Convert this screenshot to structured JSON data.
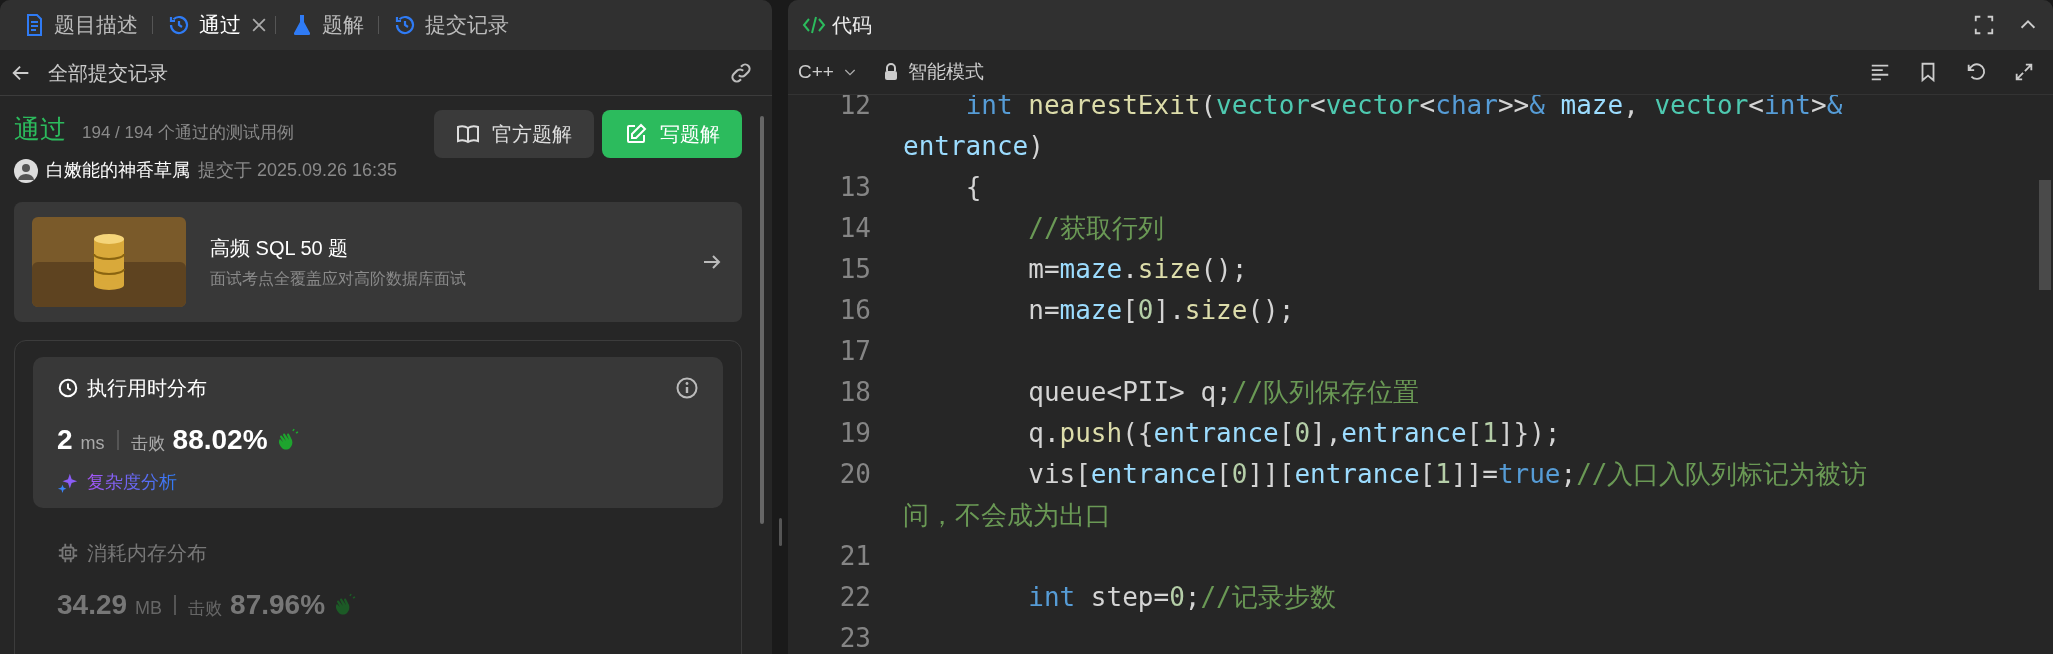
{
  "left_panel": {
    "tabs": [
      {
        "label": "题目描述",
        "selected": false,
        "closable": false
      },
      {
        "label": "通过",
        "selected": true,
        "closable": true
      },
      {
        "label": "题解",
        "selected": false,
        "closable": false
      },
      {
        "label": "提交记录",
        "selected": false,
        "closable": false
      }
    ],
    "header": {
      "title": "全部提交记录"
    },
    "submission": {
      "status": "通过",
      "cases": "194 / 194 个通过的测试用例",
      "author": "白嫩能的神香草属",
      "submitted": "提交于 2025.09.26 16:35"
    },
    "buttons": [
      {
        "label": "官方题解",
        "kind": "secondary"
      },
      {
        "label": "写题解",
        "kind": "primary"
      }
    ],
    "promo": {
      "title": "高频 SQL 50 题",
      "subtitle": "面试考点全覆盖应对高阶数据库面试"
    },
    "metrics": [
      {
        "title": "执行用时分布",
        "value": "2",
        "unit": "ms",
        "beat_label": "击败",
        "beat": "88.02%",
        "selected": true,
        "info": true,
        "analysis": "复杂度分析"
      },
      {
        "title": "消耗内存分布",
        "value": "34.29",
        "unit": "MB",
        "beat_label": "击败",
        "beat": "87.96%",
        "selected": false,
        "info": false
      }
    ]
  },
  "code_panel": {
    "title": "代码",
    "language": "C++",
    "mode": "智能模式",
    "lines": [
      {
        "number": "12",
        "tokens": [
          {
            "t": "    int",
            "kind": "kw"
          },
          {
            "t": " nearestExit",
            "kind": "fn"
          },
          {
            "t": "(",
            "kind": "plain"
          },
          {
            "t": "vector",
            "kind": "type"
          },
          {
            "t": "<",
            "kind": "plain"
          },
          {
            "t": "vector",
            "kind": "type"
          },
          {
            "t": "<",
            "kind": "plain"
          },
          {
            "t": "char",
            "kind": "kw"
          },
          {
            "t": ">>",
            "kind": "plain"
          },
          {
            "t": "&",
            "kind": "kw"
          },
          {
            "t": " maze",
            "kind": "var"
          },
          {
            "t": ", ",
            "kind": "plain"
          },
          {
            "t": "vector",
            "kind": "type"
          },
          {
            "t": "<",
            "kind": "plain"
          },
          {
            "t": "int",
            "kind": "kw"
          },
          {
            "t": ">",
            "kind": "plain"
          },
          {
            "t": "&",
            "kind": "kw"
          },
          {
            "t": " entrance",
            "kind": "var"
          },
          {
            "t": ")",
            "kind": "plain"
          }
        ]
      },
      {
        "number": "13",
        "tokens": [
          {
            "t": "    {",
            "kind": "plain"
          }
        ]
      },
      {
        "number": "14",
        "tokens": [
          {
            "t": "        //获取行列",
            "kind": "cmt"
          }
        ]
      },
      {
        "number": "15",
        "tokens": [
          {
            "t": "        m=",
            "kind": "plain"
          },
          {
            "t": "maze",
            "kind": "var"
          },
          {
            "t": ".",
            "kind": "plain"
          },
          {
            "t": "size",
            "kind": "fn"
          },
          {
            "t": "();",
            "kind": "plain"
          }
        ]
      },
      {
        "number": "16",
        "tokens": [
          {
            "t": "        n=",
            "kind": "plain"
          },
          {
            "t": "maze",
            "kind": "var"
          },
          {
            "t": "[",
            "kind": "plain"
          },
          {
            "t": "0",
            "kind": "num"
          },
          {
            "t": "].",
            "kind": "plain"
          },
          {
            "t": "size",
            "kind": "fn"
          },
          {
            "t": "();",
            "kind": "plain"
          }
        ]
      },
      {
        "number": "17"
      },
      {
        "number": "18",
        "tokens": [
          {
            "t": "        queue<PII> q;",
            "kind": "plain"
          },
          {
            "t": "//队列保存位置",
            "kind": "cmt"
          }
        ]
      },
      {
        "number": "19",
        "tokens": [
          {
            "t": "        q.",
            "kind": "plain"
          },
          {
            "t": "push",
            "kind": "fn"
          },
          {
            "t": "({",
            "kind": "plain"
          },
          {
            "t": "entrance",
            "kind": "var"
          },
          {
            "t": "[",
            "kind": "plain"
          },
          {
            "t": "0",
            "kind": "num"
          },
          {
            "t": "],",
            "kind": "plain"
          },
          {
            "t": "entrance",
            "kind": "var"
          },
          {
            "t": "[",
            "kind": "plain"
          },
          {
            "t": "1",
            "kind": "num"
          },
          {
            "t": "]});",
            "kind": "plain"
          }
        ]
      },
      {
        "number": "20",
        "tokens": [
          {
            "t": "        vis[",
            "kind": "plain"
          },
          {
            "t": "entrance",
            "kind": "var"
          },
          {
            "t": "[",
            "kind": "plain"
          },
          {
            "t": "0",
            "kind": "num"
          },
          {
            "t": "]][",
            "kind": "plain"
          },
          {
            "t": "entrance",
            "kind": "var"
          },
          {
            "t": "[",
            "kind": "plain"
          },
          {
            "t": "1",
            "kind": "num"
          },
          {
            "t": "]]=",
            "kind": "plain"
          },
          {
            "t": "true",
            "kind": "kw"
          },
          {
            "t": ";",
            "kind": "plain"
          },
          {
            "t": "//入口入队列标记为被访问，不会成为出口",
            "kind": "cmt"
          }
        ]
      },
      {
        "number": "21"
      },
      {
        "number": "22",
        "tokens": [
          {
            "t": "        int",
            "kind": "kw"
          },
          {
            "t": " step=",
            "kind": "plain"
          },
          {
            "t": "0",
            "kind": "num"
          },
          {
            "t": ";",
            "kind": "plain"
          },
          {
            "t": "//记录步数",
            "kind": "cmt"
          }
        ]
      },
      {
        "number": "23"
      }
    ]
  }
}
